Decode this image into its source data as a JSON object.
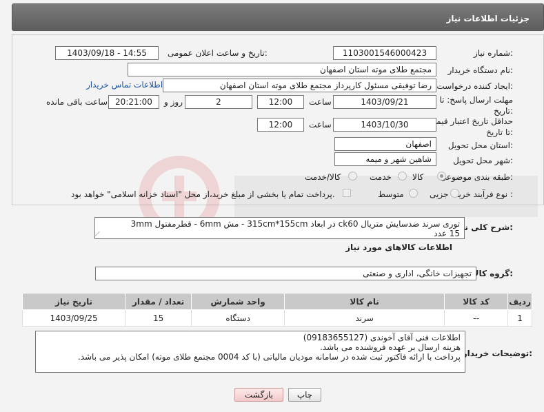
{
  "header": {
    "title": "جزئیات اطلاعات نیاز"
  },
  "form": {
    "need_number_label": "شماره نیاز:",
    "need_number": "1103001546000423",
    "announce_label": "تاریخ و ساعت اعلان عمومی:",
    "announce_value": "1403/09/18 - 14:55",
    "buyer_org_label": "نام دستگاه خریدار:",
    "buyer_org": "مجتمع طلای موته استان اصفهان",
    "creator_label": "ایجاد کننده درخواست:",
    "creator": "رضا توفیقی مسئول کارپرداز مجتمع طلای موته استان اصفهان",
    "contact_link": "اطلاعات تماس خریدار",
    "reply_deadline_label": "مهلت ارسال پاسخ: تا تاریخ:",
    "reply_date": "1403/09/21",
    "time_label": "ساعت",
    "reply_time": "12:00",
    "reply_days": "2",
    "days_label": "روز و",
    "remaining_time": "20:21:00",
    "remaining_label": "ساعت باقی مانده",
    "price_validity_label": "حداقل تاریخ اعتبار قیمت: تا تاریخ:",
    "validity_date": "1403/10/30",
    "validity_time": "12:00",
    "province_label": "استان محل تحویل:",
    "province": "اصفهان",
    "city_label": "شهر محل تحویل:",
    "city": "شاهین شهر و میمه",
    "category_label": "طبقه بندی موضوعی:",
    "category_options": [
      "کالا",
      "خدمت",
      "کالا/خدمت"
    ],
    "process_label": "نوع فرآیند خرید :",
    "process_options": [
      "جزیی",
      "متوسط"
    ],
    "payment_note": "پرداخت تمام یا بخشی از مبلغ خرید،از محل \"اسناد خزانه اسلامی\" خواهد بود."
  },
  "summary": {
    "label": "شرح کلی نیاز:",
    "line1": "توری سرند ضدسایش متریال ck60 در ابعاد  315cm*155cm - مش 6mm - قطرمفتول 3mm",
    "line2": "15 عدد"
  },
  "goods": {
    "section_title": "اطلاعات کالاهای مورد نیاز",
    "group_label": "گروه کالا:",
    "group_value": "تجهیزات خانگی، اداری و صنعتی",
    "columns": [
      "ردیف",
      "کد کالا",
      "نام کالا",
      "واحد شمارش",
      "تعداد / مقدار",
      "تاریخ نیاز"
    ],
    "rows": [
      {
        "row": "1",
        "code": "--",
        "name": "سرند",
        "unit": "دستگاه",
        "qty": "15",
        "date": "1403/09/25"
      }
    ]
  },
  "buyer_notes": {
    "label": "توضیحات خریدار:",
    "line1": "اطلاعات فنی آقای آخوندی (09183655127)",
    "line2": "هزینه ارسال بر عهده فروشنده می باشد.",
    "line3": "پرداخت با ارائه فاکتور ثبت شده در سامانه مودیان مالیاتی (با کد 0004 مجتمع طلای موته) امکان پذیر می باشد."
  },
  "buttons": {
    "print": "چاپ",
    "back": "بازگشت"
  },
  "colors": {
    "header_bg": "#6b6b6b",
    "link": "#1d55a8",
    "table_header": "#c9c9c9"
  }
}
